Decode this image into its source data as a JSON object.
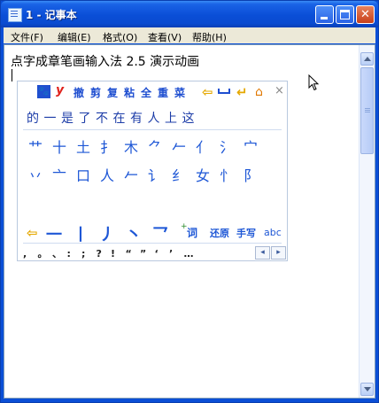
{
  "window": {
    "title": "1 - 记事本"
  },
  "title_buttons": {
    "minimize": "",
    "maximize": "",
    "close": "✕"
  },
  "menu": [
    "文件(F)",
    "编辑(E)",
    "格式(O)",
    "查看(V)",
    "帮助(H)"
  ],
  "document": {
    "text": "点字成章笔画输入法 2.5 演示动画"
  },
  "ime": {
    "toolbar": {
      "paw_glyph": "🐾",
      "y_label": "y",
      "buttons": [
        "撤",
        "剪",
        "复",
        "粘",
        "全",
        "重",
        "菜"
      ],
      "backspace_glyph": "⇦",
      "enter_glyph": "↵",
      "home_glyph": "⌂",
      "close_glyph": "×"
    },
    "candidates": [
      "的",
      "一",
      "是",
      "了",
      "不",
      "在",
      "有",
      "人",
      "上",
      "这"
    ],
    "stroke_rows": [
      [
        "艹",
        "十",
        "土",
        "扌",
        "木",
        "⺈",
        "𠂉",
        "亻",
        "氵",
        "宀"
      ],
      [
        "丷",
        "亠",
        "口",
        "人",
        "𠂉",
        "讠",
        "纟",
        "女",
        "忄",
        "阝"
      ]
    ],
    "bottom_row": {
      "back_glyph": "⇦",
      "strokes": [
        "一",
        "丨",
        "丿",
        "丶",
        "乛"
      ],
      "ci_plus": "+",
      "ci": "词",
      "restore": "还原",
      "handwrite": "手写",
      "abc": "abc"
    },
    "punctuation": [
      ",",
      "。",
      "、",
      ":",
      ";",
      "?",
      "!",
      "“",
      "”",
      "‘",
      "’",
      "…"
    ],
    "pager": {
      "prev": "◂",
      "next": "▸"
    }
  },
  "colors": {
    "titlebar": "#0a4ed7",
    "menubar": "#ece9d8",
    "ime_text": "#1e57d6",
    "close_button": "#c8401b"
  }
}
